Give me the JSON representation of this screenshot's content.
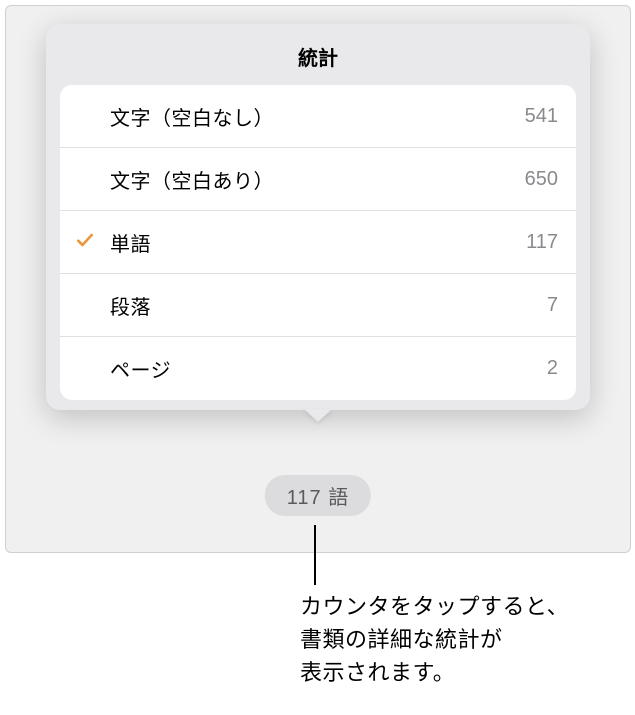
{
  "popover": {
    "title": "統計"
  },
  "stats": [
    {
      "label": "文字（空白なし）",
      "value": "541",
      "selected": false
    },
    {
      "label": "文字（空白あり）",
      "value": "650",
      "selected": false
    },
    {
      "label": "単語",
      "value": "117",
      "selected": true
    },
    {
      "label": "段落",
      "value": "7",
      "selected": false
    },
    {
      "label": "ページ",
      "value": "2",
      "selected": false
    }
  ],
  "counter": {
    "text": "117 語"
  },
  "callout": {
    "line1": "カウンタをタップすると、",
    "line2": "書類の詳細な統計が",
    "line3": "表示されます。"
  },
  "colors": {
    "accent": "#e8993e"
  }
}
